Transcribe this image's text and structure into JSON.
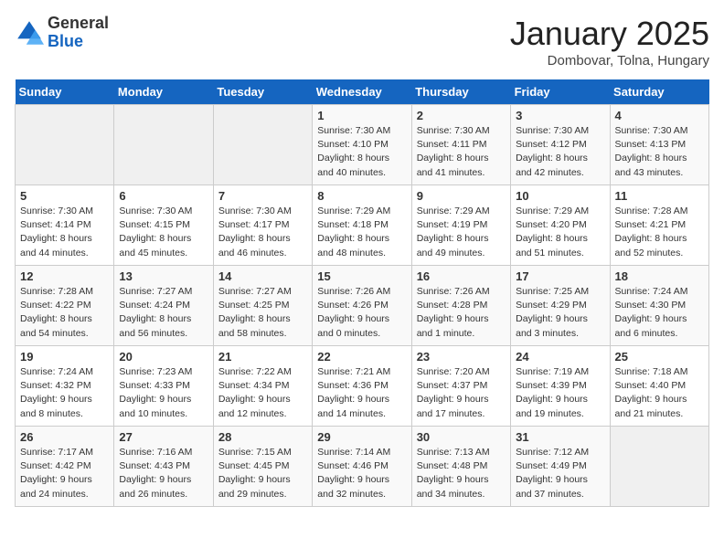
{
  "logo": {
    "general": "General",
    "blue": "Blue"
  },
  "title": "January 2025",
  "location": "Dombovar, Tolna, Hungary",
  "days_header": [
    "Sunday",
    "Monday",
    "Tuesday",
    "Wednesday",
    "Thursday",
    "Friday",
    "Saturday"
  ],
  "weeks": [
    [
      {
        "day": "",
        "content": ""
      },
      {
        "day": "",
        "content": ""
      },
      {
        "day": "",
        "content": ""
      },
      {
        "day": "1",
        "content": "Sunrise: 7:30 AM\nSunset: 4:10 PM\nDaylight: 8 hours\nand 40 minutes."
      },
      {
        "day": "2",
        "content": "Sunrise: 7:30 AM\nSunset: 4:11 PM\nDaylight: 8 hours\nand 41 minutes."
      },
      {
        "day": "3",
        "content": "Sunrise: 7:30 AM\nSunset: 4:12 PM\nDaylight: 8 hours\nand 42 minutes."
      },
      {
        "day": "4",
        "content": "Sunrise: 7:30 AM\nSunset: 4:13 PM\nDaylight: 8 hours\nand 43 minutes."
      }
    ],
    [
      {
        "day": "5",
        "content": "Sunrise: 7:30 AM\nSunset: 4:14 PM\nDaylight: 8 hours\nand 44 minutes."
      },
      {
        "day": "6",
        "content": "Sunrise: 7:30 AM\nSunset: 4:15 PM\nDaylight: 8 hours\nand 45 minutes."
      },
      {
        "day": "7",
        "content": "Sunrise: 7:30 AM\nSunset: 4:17 PM\nDaylight: 8 hours\nand 46 minutes."
      },
      {
        "day": "8",
        "content": "Sunrise: 7:29 AM\nSunset: 4:18 PM\nDaylight: 8 hours\nand 48 minutes."
      },
      {
        "day": "9",
        "content": "Sunrise: 7:29 AM\nSunset: 4:19 PM\nDaylight: 8 hours\nand 49 minutes."
      },
      {
        "day": "10",
        "content": "Sunrise: 7:29 AM\nSunset: 4:20 PM\nDaylight: 8 hours\nand 51 minutes."
      },
      {
        "day": "11",
        "content": "Sunrise: 7:28 AM\nSunset: 4:21 PM\nDaylight: 8 hours\nand 52 minutes."
      }
    ],
    [
      {
        "day": "12",
        "content": "Sunrise: 7:28 AM\nSunset: 4:22 PM\nDaylight: 8 hours\nand 54 minutes."
      },
      {
        "day": "13",
        "content": "Sunrise: 7:27 AM\nSunset: 4:24 PM\nDaylight: 8 hours\nand 56 minutes."
      },
      {
        "day": "14",
        "content": "Sunrise: 7:27 AM\nSunset: 4:25 PM\nDaylight: 8 hours\nand 58 minutes."
      },
      {
        "day": "15",
        "content": "Sunrise: 7:26 AM\nSunset: 4:26 PM\nDaylight: 9 hours\nand 0 minutes."
      },
      {
        "day": "16",
        "content": "Sunrise: 7:26 AM\nSunset: 4:28 PM\nDaylight: 9 hours\nand 1 minute."
      },
      {
        "day": "17",
        "content": "Sunrise: 7:25 AM\nSunset: 4:29 PM\nDaylight: 9 hours\nand 3 minutes."
      },
      {
        "day": "18",
        "content": "Sunrise: 7:24 AM\nSunset: 4:30 PM\nDaylight: 9 hours\nand 6 minutes."
      }
    ],
    [
      {
        "day": "19",
        "content": "Sunrise: 7:24 AM\nSunset: 4:32 PM\nDaylight: 9 hours\nand 8 minutes."
      },
      {
        "day": "20",
        "content": "Sunrise: 7:23 AM\nSunset: 4:33 PM\nDaylight: 9 hours\nand 10 minutes."
      },
      {
        "day": "21",
        "content": "Sunrise: 7:22 AM\nSunset: 4:34 PM\nDaylight: 9 hours\nand 12 minutes."
      },
      {
        "day": "22",
        "content": "Sunrise: 7:21 AM\nSunset: 4:36 PM\nDaylight: 9 hours\nand 14 minutes."
      },
      {
        "day": "23",
        "content": "Sunrise: 7:20 AM\nSunset: 4:37 PM\nDaylight: 9 hours\nand 17 minutes."
      },
      {
        "day": "24",
        "content": "Sunrise: 7:19 AM\nSunset: 4:39 PM\nDaylight: 9 hours\nand 19 minutes."
      },
      {
        "day": "25",
        "content": "Sunrise: 7:18 AM\nSunset: 4:40 PM\nDaylight: 9 hours\nand 21 minutes."
      }
    ],
    [
      {
        "day": "26",
        "content": "Sunrise: 7:17 AM\nSunset: 4:42 PM\nDaylight: 9 hours\nand 24 minutes."
      },
      {
        "day": "27",
        "content": "Sunrise: 7:16 AM\nSunset: 4:43 PM\nDaylight: 9 hours\nand 26 minutes."
      },
      {
        "day": "28",
        "content": "Sunrise: 7:15 AM\nSunset: 4:45 PM\nDaylight: 9 hours\nand 29 minutes."
      },
      {
        "day": "29",
        "content": "Sunrise: 7:14 AM\nSunset: 4:46 PM\nDaylight: 9 hours\nand 32 minutes."
      },
      {
        "day": "30",
        "content": "Sunrise: 7:13 AM\nSunset: 4:48 PM\nDaylight: 9 hours\nand 34 minutes."
      },
      {
        "day": "31",
        "content": "Sunrise: 7:12 AM\nSunset: 4:49 PM\nDaylight: 9 hours\nand 37 minutes."
      },
      {
        "day": "",
        "content": ""
      }
    ]
  ]
}
